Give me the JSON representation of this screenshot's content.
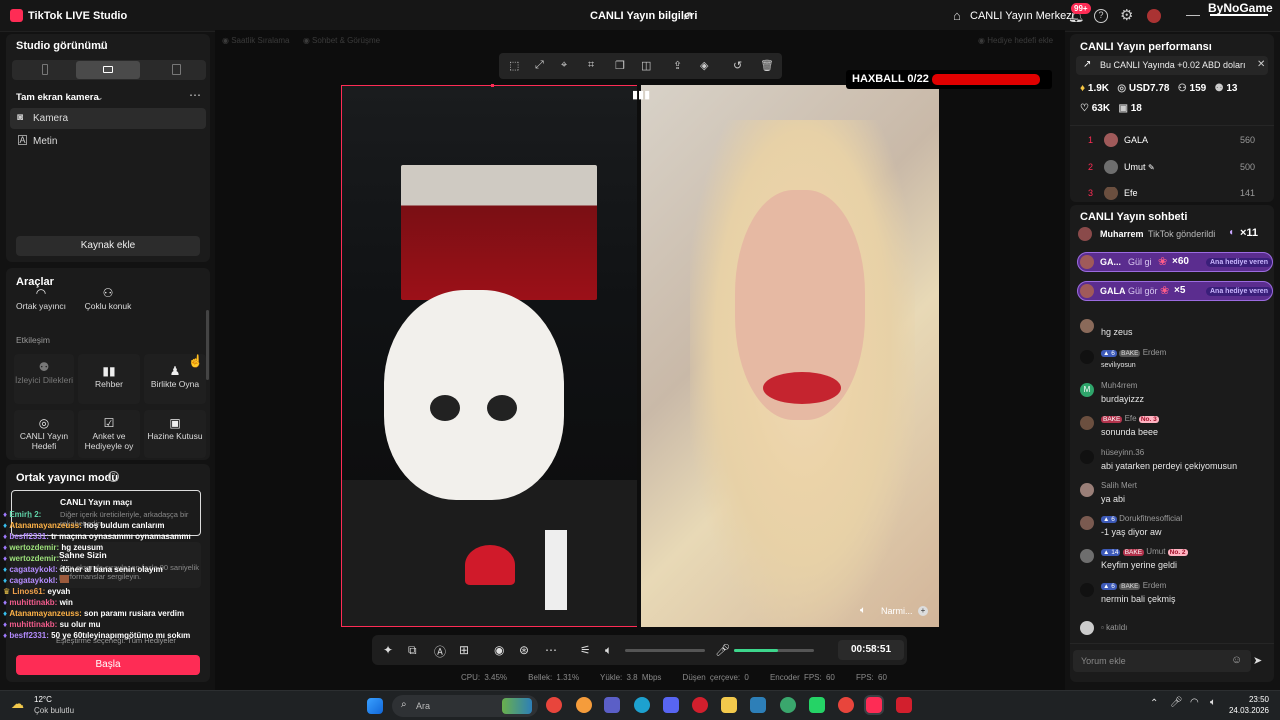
{
  "app": {
    "title": "TikTok LIVE Studio",
    "center_title": "CANLI Yayın bilgileri",
    "center_link": "CANLI Yayın Merkezi",
    "notif_count": "99+",
    "brand": "ByNoGame"
  },
  "left": {
    "studio_view": "Studio görünümü",
    "scene": "Tam ekran kamera",
    "sources": [
      "Kamera",
      "Metin"
    ],
    "add_source": "Kaynak ekle",
    "tools_title": "Araçlar",
    "tools_top": [
      "Ortak yayıncı",
      "Çoklu konuk"
    ],
    "interaction": "Etkileşim",
    "tools_row1": [
      "İzleyici Dilekleri",
      "Rehber",
      "Birlikte Oyna"
    ],
    "tools_row2": [
      "CANLI Yayın Hedefi",
      "Anket ve Hediyeyle oy",
      "Hazine Kutusu"
    ],
    "cohost_mode": "Ortak yayıncı modu",
    "match_title": "CANLI Yayın maçı",
    "match_desc": "Diğer içerik üreticileriyle, arkadaşça bir rekabet edin.",
    "multi_title": "Sahne Sizin",
    "multi_desc": "Aynı ekranda sırayla, en fazla 90 saniyelik performanslar sergileyin.",
    "connect_desc": "Eşleştirme seçeneği: Tüm Hediyeler",
    "start": "Başla",
    "overlay_chat": [
      {
        "user": "Emirh̲ 2:",
        "msg": ""
      },
      {
        "user": "Atanamayanzeuss:",
        "msg": "hoş buldum canlarım"
      },
      {
        "user": "besff2331:",
        "msg": "tr maçına oynasammı oynamasammı"
      },
      {
        "user": "wertozdemir:",
        "msg": "hg zeusum"
      },
      {
        "user": "wertozdemir:",
        "msg": "..."
      },
      {
        "user": "cagataykokl:",
        "msg": "döner al bana senin olayım"
      },
      {
        "user": "cagataykokl:",
        "msg": ""
      },
      {
        "user": "Linos61:",
        "msg": "eyvah"
      },
      {
        "user": "muhittinakb:",
        "msg": "win"
      },
      {
        "user": "Atanamayanzeuss:",
        "msg": "son paramı rusiara verdim"
      },
      {
        "user": "muhittinakb:",
        "msg": "su olur mu"
      },
      {
        "user": "besff2331:",
        "msg": "50 ye 60tıleyinapımgötümo mı sokım"
      }
    ]
  },
  "center": {
    "faded_left_1": "Saatlik Sıralama",
    "faded_left_2": "Sohbet & Görüşme",
    "faded_right": "Hediye hedefi ekle",
    "haxball": "HAXBALL 0/22",
    "haxball_progress": 0.95,
    "guest_name": "Narmi...",
    "timer": "00:58:51",
    "stats": {
      "cpu": "CPU: 3.45%",
      "mem": "Bellek: 1.31%",
      "upload": "Yükle: 3.8 Mbps",
      "dropped": "Düşen çerçeve: 0",
      "encoder": "Encoder FPS: 60",
      "fps": "FPS: 60"
    }
  },
  "right": {
    "perf_title": "CANLI Yayın performansı",
    "earn_note": "Bu CANLI Yayında +0.02 ABD doları",
    "metrics": {
      "diamonds": "1.9K",
      "usd": "USD7.78",
      "viewers": "159",
      "followers": "13",
      "likes": "63K",
      "gifters": "18"
    },
    "ranking": [
      {
        "rank": "1",
        "name": "GALA",
        "value": "560"
      },
      {
        "rank": "2",
        "name": "Umut",
        "value": "500"
      },
      {
        "rank": "3",
        "name": "Efe",
        "value": "141"
      }
    ],
    "chat_title": "CANLI Yayın sohbeti",
    "gift_line": {
      "user": "Muharrem",
      "text": "TikTok gönderildi",
      "count": "×11"
    },
    "gift_pills": [
      {
        "user": "GA...",
        "text": "Gül gi",
        "count": "×60",
        "tag": "Ana hediye veren"
      },
      {
        "user": "GALA",
        "text": "Gül gör",
        "count": "×5",
        "tag": "Ana hediye veren"
      }
    ],
    "messages": [
      {
        "name": "",
        "level": "",
        "fan": "",
        "msg": "hg zeus",
        "color": "#8a6a5a"
      },
      {
        "name": "Erdem",
        "level": "6",
        "fan": "BAKE",
        "msg": "sevilıyosun",
        "color": "#111"
      },
      {
        "name": "Muh4rrem",
        "level": "",
        "fan": "",
        "msg": "burdayizzz",
        "color": "#2fa56b"
      },
      {
        "name": "Efe",
        "level": "",
        "fan": "BAKE",
        "msg": "sonunda beee",
        "color": "#6b4f3f",
        "no": "No. 3"
      },
      {
        "name": "hüseyinn.36",
        "level": "",
        "fan": "",
        "msg": "abi yatarken perdeyi çekiyomusun",
        "color": "#111"
      },
      {
        "name": "Salih Mert",
        "level": "",
        "fan": "",
        "msg": "ya abi",
        "color": "#9a7f78"
      },
      {
        "name": "Dorukfitnesofficial",
        "level": "6",
        "fan": "",
        "msg": "-1 yaş diyor aw",
        "color": "#7a5a50"
      },
      {
        "name": "Umut",
        "level": "14",
        "fan": "BAKE",
        "msg": "Keyfim yerine geldi",
        "color": "#6e6e6e",
        "no": "No. 2"
      },
      {
        "name": "Erdem",
        "level": "6",
        "fan": "BAKE",
        "msg": "nermin bali çekmiş",
        "color": "#111"
      }
    ],
    "joined": "katıldı",
    "comment_placeholder": "Yorum ekle"
  },
  "taskbar": {
    "temp": "12°C",
    "weather": "Çok bulutlu",
    "search": "Ara",
    "time": "23:50",
    "date": "24.03.2026"
  }
}
